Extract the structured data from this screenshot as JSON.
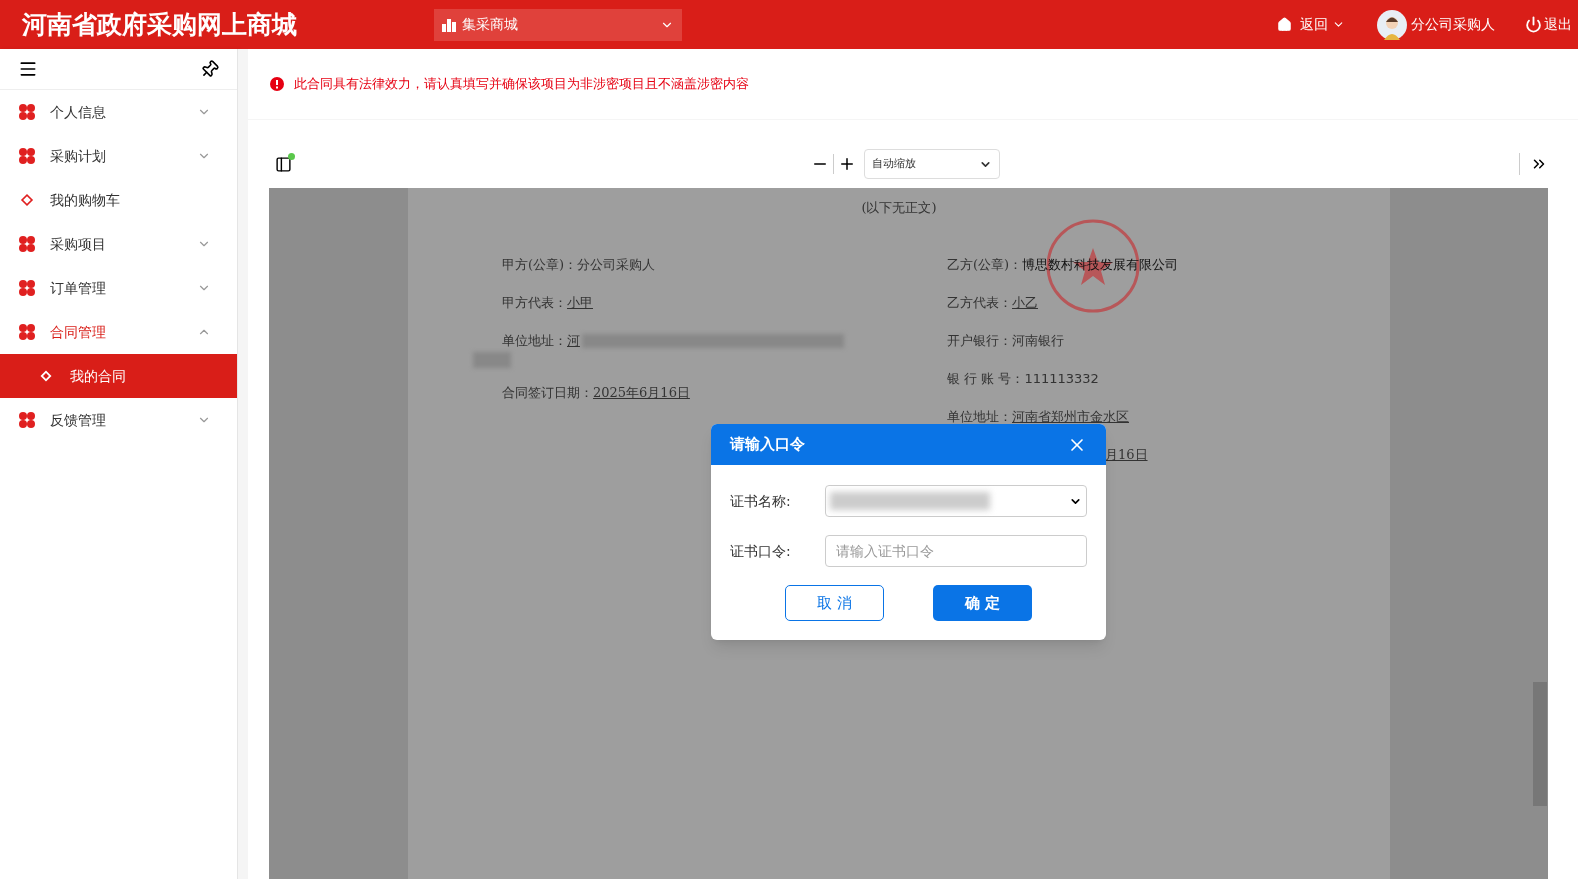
{
  "header": {
    "title": "河南省政府采购网上商城",
    "mall_selector": "集采商城",
    "back": "返回",
    "user": "分公司采购人",
    "logout": "退出"
  },
  "sidebar": {
    "items": [
      {
        "label": "个人信息",
        "kind": "group",
        "expanded": false
      },
      {
        "label": "采购计划",
        "kind": "group",
        "expanded": false
      },
      {
        "label": "我的购物车",
        "kind": "link",
        "selected": false
      },
      {
        "label": "采购项目",
        "kind": "group",
        "expanded": false
      },
      {
        "label": "订单管理",
        "kind": "group",
        "expanded": false
      },
      {
        "label": "合同管理",
        "kind": "group",
        "expanded": true,
        "children": [
          {
            "label": "我的合同",
            "selected": true
          }
        ]
      },
      {
        "label": "反馈管理",
        "kind": "group",
        "expanded": false
      }
    ]
  },
  "alert": "此合同具有法律效力，请认真填写并确保该项目为非涉密项目且不涵盖涉密内容",
  "viewer": {
    "zoom": "自动缩放"
  },
  "document": {
    "note": "(以下无正文)",
    "left": [
      {
        "label": "甲方(公章)：",
        "value": "分公司采购人",
        "underline": false,
        "blurred": false
      },
      {
        "label": "甲方代表：",
        "value": "小甲",
        "underline": true,
        "blurred": false
      },
      {
        "label": "单位地址：",
        "value": "河",
        "underline": true,
        "blurred": true
      },
      {
        "label": "合同签订日期：",
        "value": "2025年6月16日",
        "underline": true,
        "blurred": false
      }
    ],
    "right": [
      {
        "label": "乙方(公章)：",
        "value": "博思数村科技发展有限公司",
        "underline": false
      },
      {
        "label": "乙方代表：",
        "value": "小乙",
        "underline": true
      },
      {
        "label": "开户银行：",
        "value": "河南银行",
        "underline": false
      },
      {
        "label": "银 行 账 号：",
        "value": "111113332",
        "underline": false
      },
      {
        "label": "单位地址：",
        "value": "河南省郑州市金水区",
        "underline": true
      }
    ],
    "date_tail": "月16日"
  },
  "dialog": {
    "title": "请输入口令",
    "fields": [
      {
        "kind": "select",
        "label": "证书名称:",
        "blurred": true
      },
      {
        "kind": "input",
        "label": "证书口令:",
        "placeholder": "请输入证书口令"
      }
    ],
    "buttons": [
      {
        "label": "取 消",
        "kind": "secondary"
      },
      {
        "label": "确 定",
        "kind": "primary"
      }
    ]
  }
}
